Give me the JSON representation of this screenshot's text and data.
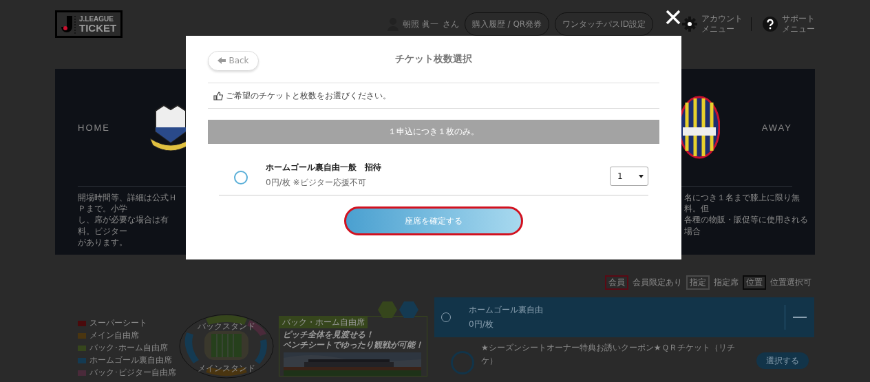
{
  "header": {
    "logo": {
      "line1": "J.LEAGUE",
      "line2": "TICKET"
    },
    "user_name": "朝照 眞一",
    "user_suffix": "さん",
    "buttons": [
      "購入履歴 / QR発券",
      "ワンタッチパスID設定"
    ],
    "menus": [
      {
        "kind": "account",
        "line1": "アカウント",
        "line2": "メニュー"
      },
      {
        "kind": "support",
        "line1": "サポート",
        "line2": "メニュー"
      }
    ]
  },
  "match": {
    "home_label": "HOME",
    "away_label": "AWAY",
    "notes_left": [
      "開場時間等、詳細は公式ＨＰまで。小学",
      "し、席が必要な場合は有料。ビジター",
      "があります。"
    ],
    "notes_right": [
      "名につき１名まで膝上に限り無料。但",
      "各種の物販・販促等に使用される場合"
    ]
  },
  "ticket_marks": [
    {
      "badge": "会員",
      "label": "会員限定あり",
      "color": "#5a0a14"
    },
    {
      "badge": "指定",
      "label": "指定席",
      "color": "#4a4a4a"
    },
    {
      "badge": "位置",
      "label": "位置選択可",
      "color": "#0a0a0a"
    }
  ],
  "seat_legend": [
    {
      "label": "スーパーシート",
      "color": "#4a0a0c"
    },
    {
      "label": "メイン自由席",
      "color": "#4a3510"
    },
    {
      "label": "バック･ホーム自由席",
      "color": "#36461c"
    },
    {
      "label": "ホームゴール裏自由席",
      "color": "#143a52"
    },
    {
      "label": "バック･ビジター自由席",
      "color": "#4a2a3a"
    }
  ],
  "stadium_labels": [
    "バックスタンド",
    "メインスタンド"
  ],
  "promo": {
    "tag": "バック・ホーム自由席",
    "headline": [
      "ピッチ全体を見渡せる！",
      "ベンチシートでゆったり観戦が可能！"
    ]
  },
  "seat_section": {
    "name": "ホームゴール裏自由",
    "price": "0円/枚",
    "expanded": true
  },
  "offers": [
    {
      "name": "★シーズンシートオーナー特典お誘いクーポン★ＱＲチケット（リチケ）",
      "selected": false,
      "button": "選択する"
    }
  ],
  "modal": {
    "back": "Back",
    "title": "チケット枚数選択",
    "instruction": "ご希望のチケットと枚数をお選びください。",
    "notice": "１申込につき１枚のみ。",
    "tickets": [
      {
        "name": "ホームゴール裏自由一般　招待",
        "note": "0円/枚 ※ビジター応援不可",
        "selected": false,
        "quantity": "1"
      }
    ],
    "confirm": "座席を確定する",
    "confirm_highlighted": true
  }
}
